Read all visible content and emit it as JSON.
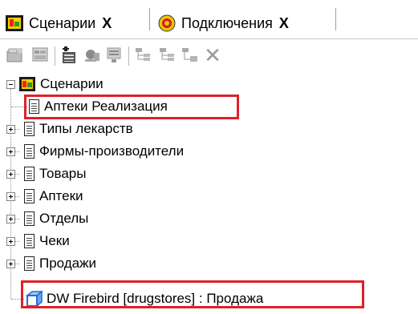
{
  "tabs": [
    {
      "label": "Сценарии",
      "close": "X",
      "icon": "scenario-icon"
    },
    {
      "label": "Подключения",
      "close": "X",
      "icon": "connection-icon"
    }
  ],
  "toolbar": {
    "buttons": [
      "open-icon",
      "grid-icon",
      "add-icon",
      "record-icon",
      "edit-icon",
      "tree-icon-1",
      "tree-icon-2",
      "tree-icon-3",
      "delete-icon"
    ],
    "delete_glyph": "✕"
  },
  "tree": {
    "root": {
      "label": "Сценарии",
      "icon": "scenario-icon"
    },
    "items": [
      {
        "label": "Аптеки Реализация",
        "expandable": false,
        "highlighted": true
      },
      {
        "label": "Типы лекарств",
        "expandable": true
      },
      {
        "label": "Фирмы-производители",
        "expandable": true
      },
      {
        "label": "Товары",
        "expandable": true
      },
      {
        "label": "Аптеки",
        "expandable": true
      },
      {
        "label": "Отделы",
        "expandable": true
      },
      {
        "label": "Чеки",
        "expandable": true
      },
      {
        "label": "Продажи",
        "expandable": true
      },
      {
        "label": "DW Firebird [drugstores] : Продажа",
        "expandable": false,
        "highlighted": true,
        "icon": "cube-icon"
      }
    ]
  },
  "colors": {
    "highlight": "#e0202a",
    "cube": "#1e6fd8"
  }
}
